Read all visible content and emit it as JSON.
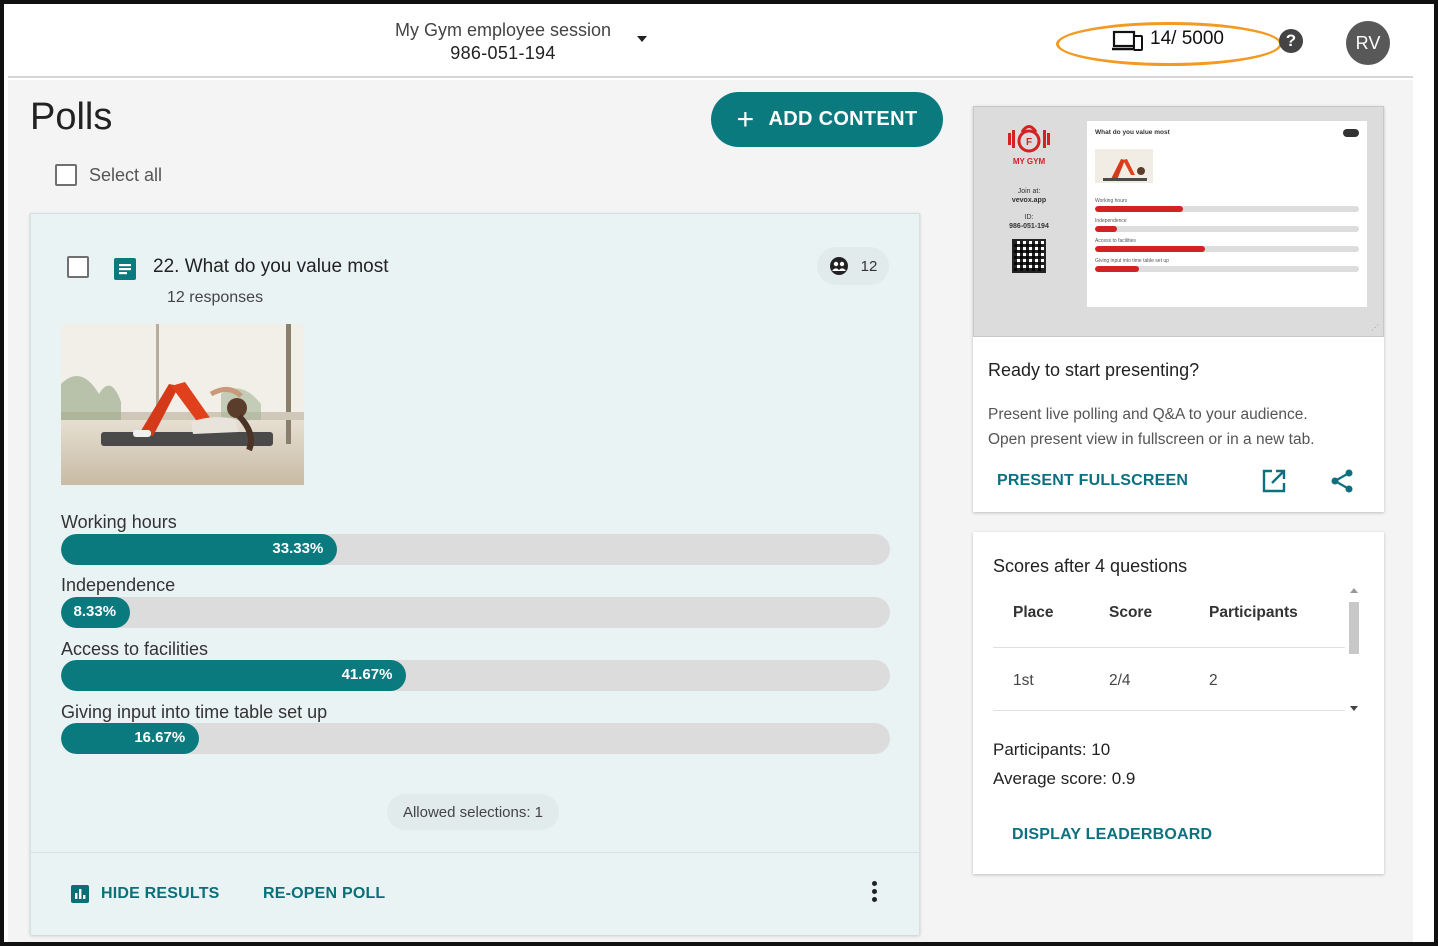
{
  "session": {
    "name": "My Gym employee session",
    "code": "986-051-194"
  },
  "header": {
    "participants_quota": "14/ 5000",
    "help_label": "?",
    "avatar_initials": "RV"
  },
  "page": {
    "title": "Polls",
    "select_all_label": "Select all",
    "add_content_label": "ADD CONTENT"
  },
  "poll": {
    "title": "22. What do you value most",
    "responses_label": "12 responses",
    "response_count": "12",
    "options": [
      {
        "label": "Working hours",
        "value_label": "33.33%",
        "percent": 33.33
      },
      {
        "label": "Independence",
        "value_label": "8.33%",
        "percent": 8.33
      },
      {
        "label": "Access to facilities",
        "value_label": "41.67%",
        "percent": 41.67
      },
      {
        "label": "Giving input into time table set up",
        "value_label": "16.67%",
        "percent": 16.67
      }
    ],
    "allowed_selections": "Allowed selections: 1",
    "hide_results_label": "HIDE RESULTS",
    "reopen_label": "RE-OPEN POLL"
  },
  "preview": {
    "brand": "MY GYM",
    "join_line1": "Join at:",
    "join_line2": "vevox.app",
    "id_line1": "ID:",
    "id_line2": "986-051-194",
    "slide_title": "What do you value most"
  },
  "present": {
    "title": "Ready to start presenting?",
    "desc_line1": "Present live polling and Q&A to your audience.",
    "desc_line2": "Open present view in fullscreen or in a new tab.",
    "fullscreen_label": "PRESENT FULLSCREEN"
  },
  "scores": {
    "title": "Scores after 4 questions",
    "columns": [
      "Place",
      "Score",
      "Participants"
    ],
    "rows": [
      {
        "place": "1st",
        "score": "2/4",
        "participants": "2"
      }
    ],
    "participants_stat": "Participants: 10",
    "average_stat": "Average score: 0.9",
    "leaderboard_label": "DISPLAY LEADERBOARD"
  },
  "colors": {
    "accent": "#0b7a7f",
    "quota_highlight": "#f29a22",
    "preview_bar": "#d42222"
  },
  "icons": [
    "device-icon",
    "help-icon",
    "document-icon",
    "group-icon",
    "bar-chart-icon",
    "open-in-new-icon",
    "share-icon",
    "kebab-icon"
  ]
}
